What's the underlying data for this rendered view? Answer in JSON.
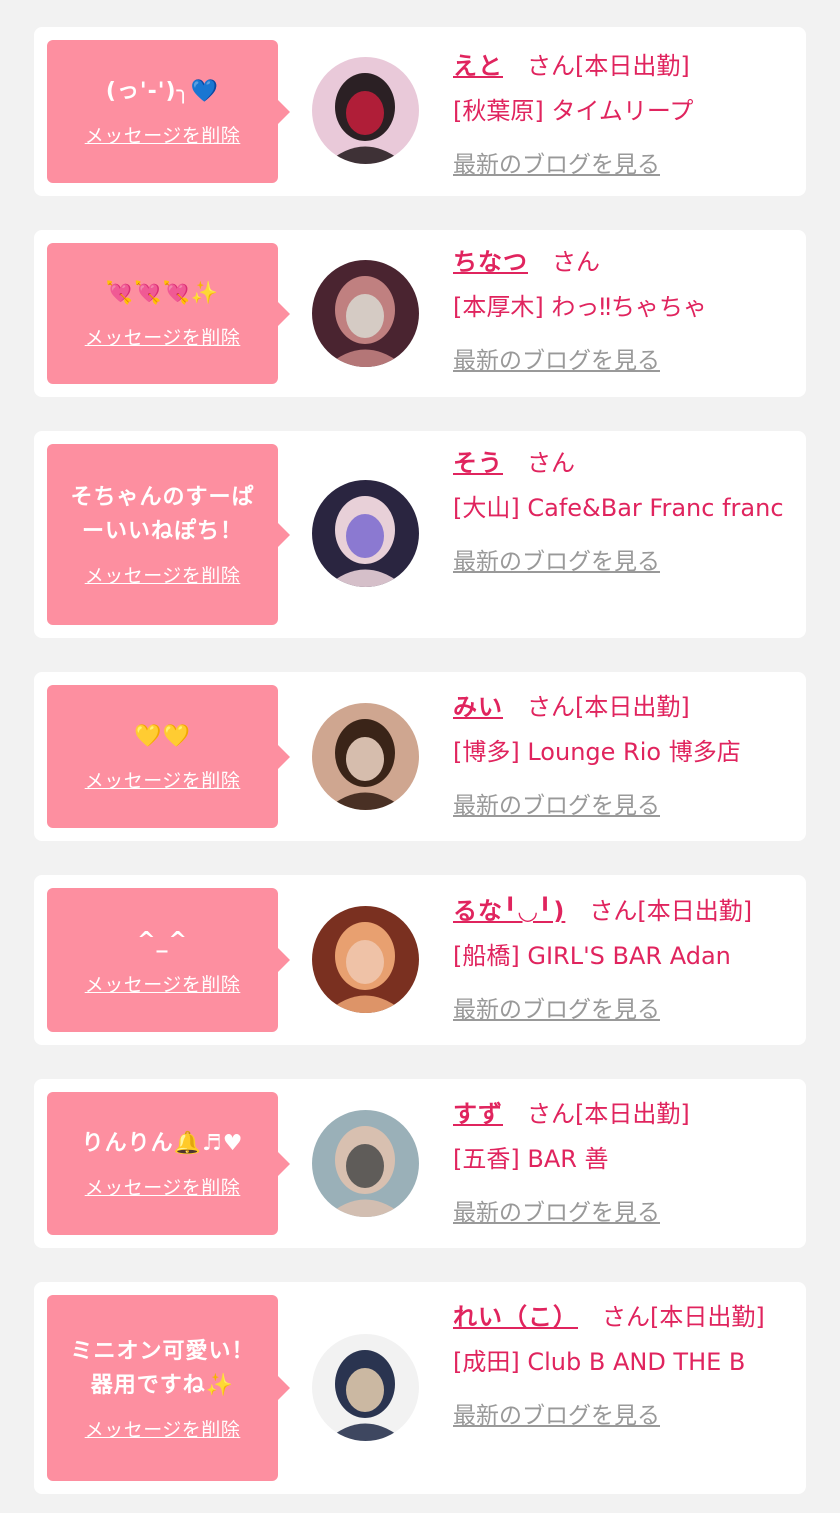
{
  "delete_label": "メッセージを削除",
  "san_label": "さん",
  "blog_label": "最新のブログを見る",
  "cards": [
    {
      "message": "(っ'-')╮💙",
      "name": "えと",
      "status": "[本日出勤]",
      "shop": "[秋葉原] タイムリープ",
      "avatar": {
        "bg": "#e9c9d9",
        "fg": "#2b2024",
        "accent": "#c81e3c",
        "icon": "cast-avatar-photo"
      }
    },
    {
      "message": "💘💘💘✨",
      "name": "ちなつ",
      "status": "",
      "shop": "[本厚木] わっ‼ちゃちゃ",
      "avatar": {
        "bg": "#4a2430",
        "fg": "#c08080",
        "accent": "#d8d8d0",
        "icon": "cast-avatar-photo"
      }
    },
    {
      "message": "そちゃんのすーぱ\nーいいねぽち！",
      "name": "そう",
      "status": "",
      "shop": "[大山] Cafe&Bar Franc franc",
      "avatar": {
        "bg": "#2a2540",
        "fg": "#e8d0d8",
        "accent": "#7a6ad0",
        "icon": "cast-avatar-photo"
      }
    },
    {
      "message": "💛💛",
      "name": "みい",
      "status": "[本日出勤]",
      "shop": "[博多] Lounge Rio 博多店",
      "avatar": {
        "bg": "#cfa690",
        "fg": "#3a2418",
        "accent": "#f2d8c8",
        "icon": "cast-avatar-photo"
      }
    },
    {
      "message": "^_^",
      "name": "るな╹◡╹)",
      "status": "[本日出勤]",
      "shop": "[船橋] GIRL'S BAR Adan",
      "avatar": {
        "bg": "#7a3020",
        "fg": "#e8a070",
        "accent": "#f0c8b0",
        "icon": "cast-avatar-photo"
      }
    },
    {
      "message": "りんりん🔔♬♥",
      "name": "すず",
      "status": "[本日出勤]",
      "shop": "[五香] BAR 善",
      "avatar": {
        "bg": "#9ab0b8",
        "fg": "#d8c0b0",
        "accent": "#4a4a4a",
        "icon": "cast-avatar-photo"
      }
    },
    {
      "message": "ミニオン可愛い！\n器用ですね✨",
      "name": "れい（こ）",
      "status": "[本日出勤]",
      "shop": "[成田] Club B AND THE B",
      "avatar": {
        "bg": "#f2f2f2",
        "fg": "#2a3450",
        "accent": "#e8d0b0",
        "icon": "cast-avatar-photo"
      }
    }
  ],
  "colors": {
    "background": "#f2f2f2",
    "card": "#ffffff",
    "bubble": "#fd8fa0",
    "accent_text": "#e0245e",
    "blog_link": "#999999"
  }
}
